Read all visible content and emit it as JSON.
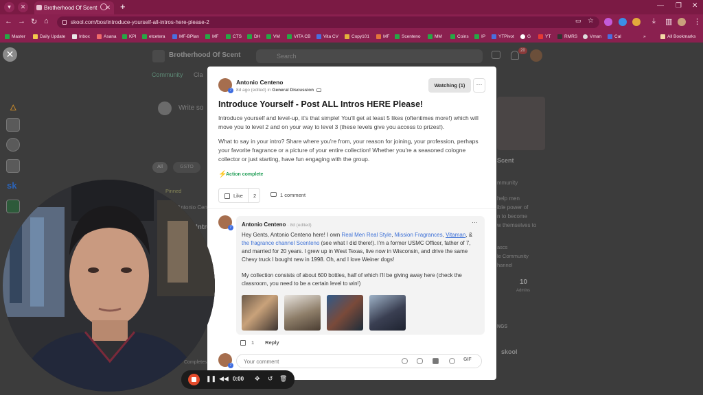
{
  "browser": {
    "tab_title": "Brotherhood Of Scent",
    "url": "skool.com/bos/introduce-yourself-all-intros-here-please-2",
    "bookmarks": [
      "Master",
      "Daily Update",
      "Inbox",
      "Asana",
      "KPI",
      "etcetera",
      "MF-BPlan",
      "MF",
      "CTS",
      "DH",
      "VM",
      "VITA CB",
      "Vita CV",
      "Copy101",
      "MF",
      "Scenteno",
      "MM",
      "Coins",
      "IP",
      "YTPivot",
      "G",
      "YT",
      "RMRS",
      "Vman",
      "Cal"
    ],
    "all_bookmarks_label": "All Bookmarks",
    "colors": {
      "chrome": "#8a204f",
      "tabbar": "#7b1a44"
    }
  },
  "background_page": {
    "group_name": "Brotherhood Of Scent",
    "search_placeholder": "Search",
    "nav_community": "Community",
    "nav_partial": "Cla",
    "write_placeholder": "Write so",
    "filter_all": "All",
    "filter_gsto": "GSTO",
    "pinned_label": "Pinned",
    "post_author_partial": "Antonio Cen",
    "post_title_partial": "Intro",
    "group_side_title": "Scent",
    "side_lines": [
      "mmunity",
      "help men",
      "ible power of",
      "n to become",
      "w themselves to"
    ],
    "side_links": [
      "ascs",
      "le Community",
      "hannel"
    ],
    "stat_value": "10",
    "stat_label": "Admins",
    "side_heading": "NGS",
    "side_brand": "skool",
    "notification_count": "20",
    "completed_label": "Completes"
  },
  "modal": {
    "author": "Antonio Centeno",
    "meta_prefix": "8d ago (edited) in",
    "category": "General Discussion",
    "watching_label": "Watching (1)",
    "more_label": "···",
    "title": "Introduce Yourself - Post ALL Intros HERE Please!",
    "paragraph1": "Introduce yourself and level-up, it's that simple! You'll get at least 5 likes (oftentimes more!) which will move you to level 2 and on your way to level 3 (these levels give you access to prizes!).",
    "paragraph2": "What to say in your intro? Share where you're from, your reason for joining, your profession, perhaps your favorite fragrance or a picture of your entire collection! Whether you're a seasoned cologne collector or just starting, have fun engaging with the group.",
    "action_label": "Action complete",
    "like_label": "Like",
    "like_count": "2",
    "comment_count_label": "1 comment",
    "comment": {
      "author": "Antonio Centeno",
      "meta": "· 8d (edited)",
      "more_label": "···",
      "p1_a": "Hey Gents, Antonio Centeno here! I own ",
      "link1": "Real Men Real Style",
      "p1_b": ", ",
      "link2": "Mission Fragrances",
      "p1_c": ", ",
      "link3": "Vitaman",
      "p1_d": ", & ",
      "link4": "the fragrance channel Scenteno",
      "p1_e": " (see what I did there!). I'm a former USMC Officer, father of 7, and married for 20 years. I grew up in West Texas, live now in Wisconsin, and drive the same Chevy truck I bought new in 1998. Oh, and I love Weiner dogs!",
      "p2": "My collection consists of about 600 bottles, half of which I'll be giving away here (check the classroom, you need to be a certain level to win!)",
      "likes": "1",
      "reply_label": "Reply"
    },
    "reply_placeholder": "Your comment",
    "gif_label": "GIF"
  },
  "recorder": {
    "time": "0:00"
  }
}
